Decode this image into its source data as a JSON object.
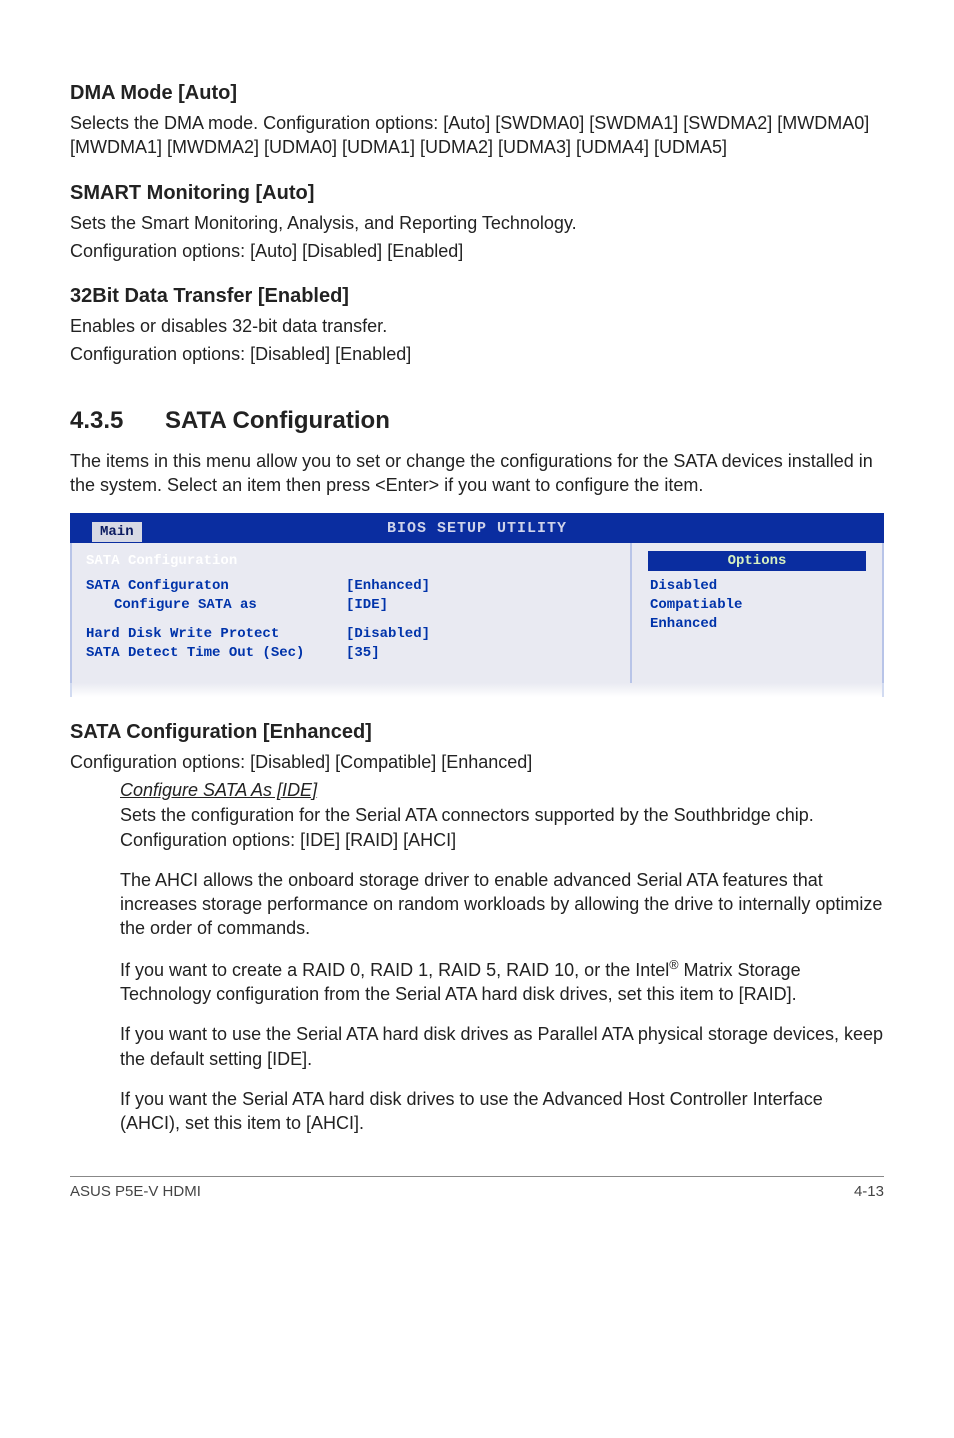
{
  "sections": {
    "dma": {
      "heading": "DMA Mode [Auto]",
      "text": "Selects the DMA mode. Configuration options: [Auto] [SWDMA0] [SWDMA1] [SWDMA2] [MWDMA0] [MWDMA1] [MWDMA2] [UDMA0] [UDMA1] [UDMA2] [UDMA3] [UDMA4] [UDMA5]"
    },
    "smart": {
      "heading": "SMART Monitoring [Auto]",
      "line1": "Sets the Smart Monitoring, Analysis, and Reporting Technology.",
      "line2": "Configuration options: [Auto] [Disabled] [Enabled]"
    },
    "transfer": {
      "heading": "32Bit Data Transfer [Enabled]",
      "line1": "Enables or disables 32-bit data transfer.",
      "line2": "Configuration options: [Disabled] [Enabled]"
    },
    "numbered": {
      "num": "4.3.5",
      "title": "SATA Configuration",
      "intro": "The items in this menu allow you to set or change the configurations for the SATA devices installed in the system. Select an item then press <Enter> if you want to configure the item."
    },
    "bios": {
      "title": "BIOS SETUP UTILITY",
      "tab": "Main",
      "panelHeader": "SATA Configuration",
      "rows": [
        {
          "label": "SATA Configuraton",
          "val": "[Enhanced]",
          "indent": false
        },
        {
          "label": "Configure SATA as",
          "val": "[IDE]",
          "indent": true
        },
        {
          "label": "Hard Disk Write Protect",
          "val": "[Disabled]",
          "indent": false
        },
        {
          "label": "SATA Detect Time Out (Sec)",
          "val": "[35]",
          "indent": false
        }
      ],
      "optionsHeader": "Options",
      "options": [
        "Disabled",
        "Compatiable",
        "Enhanced"
      ]
    },
    "sataConfig": {
      "heading": "SATA Configuration [Enhanced]",
      "text": "Configuration options: [Disabled] [Compatible] [Enhanced]"
    },
    "configSata": {
      "underline": "Configure SATA As [IDE]",
      "p1": "Sets the configuration for the Serial ATA connectors supported by the Southbridge chip. Configuration options: [IDE] [RAID] [AHCI]",
      "p2": "The AHCI allows the onboard storage driver to enable advanced Serial ATA features that increases storage performance on random workloads by allowing the drive to internally optimize the order of commands.",
      "p3a": "If you want to create a RAID 0, RAID 1, RAID 5, RAID 10, or the Intel",
      "p3sup": "®",
      "p3b": " Matrix Storage Technology configuration from the Serial ATA hard disk drives, set this item to [RAID].",
      "p4": "If you want to use the Serial ATA hard disk drives as Parallel ATA physical storage devices, keep the default setting [IDE].",
      "p5": "If you want the Serial ATA hard disk drives to use the Advanced Host Controller Interface (AHCI), set this item to [AHCI]."
    },
    "footer": {
      "left": "ASUS P5E-V HDMI",
      "right": "4-13"
    }
  },
  "chart_data": {
    "type": "table",
    "title": "BIOS SETUP UTILITY — SATA Configuration",
    "rows": [
      {
        "setting": "SATA Configuraton",
        "value": "Enhanced"
      },
      {
        "setting": "Configure SATA as",
        "value": "IDE"
      },
      {
        "setting": "Hard Disk Write Protect",
        "value": "Disabled"
      },
      {
        "setting": "SATA Detect Time Out (Sec)",
        "value": "35"
      }
    ],
    "options_panel": [
      "Disabled",
      "Compatiable",
      "Enhanced"
    ]
  }
}
